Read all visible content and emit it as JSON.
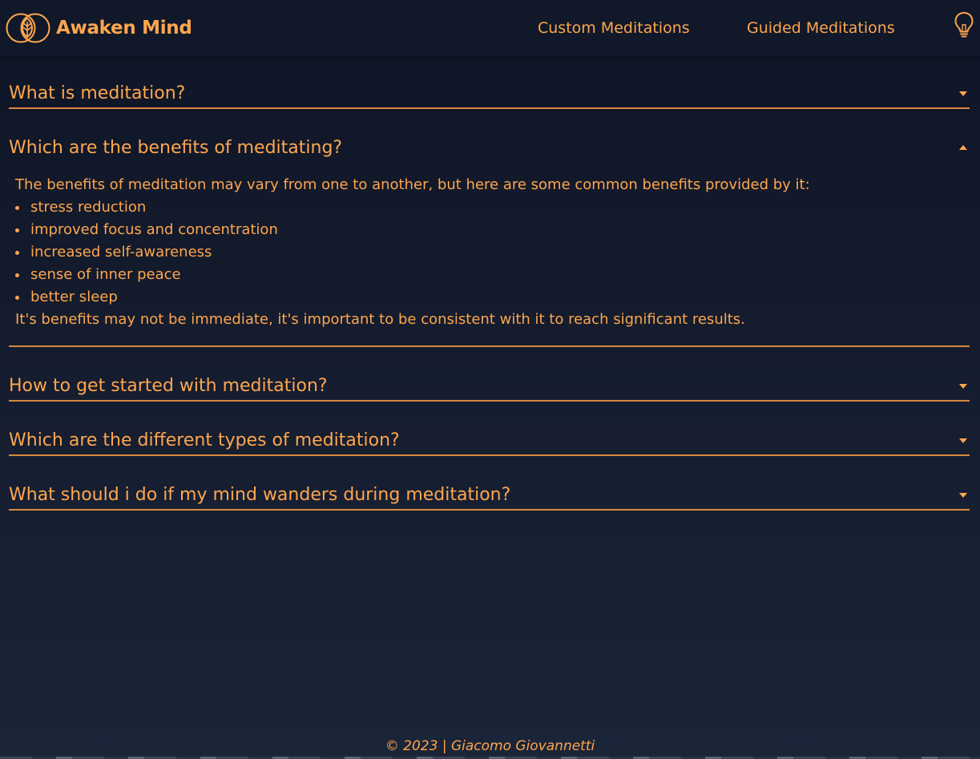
{
  "header": {
    "brand": "Awaken Mind",
    "nav": {
      "custom": "Custom Meditations",
      "guided": "Guided Meditations"
    },
    "icons": {
      "logo": "leaf-circles-icon",
      "theme": "lightbulb-icon"
    }
  },
  "faq": [
    {
      "question": "What is meditation?",
      "expanded": false
    },
    {
      "question": "Which are the benefits of meditating?",
      "expanded": true,
      "intro": "The benefits of meditation may vary from one to another, but here are some common benefits provided by it:",
      "items": [
        "stress reduction",
        "improved focus and concentration",
        "increased self-awareness",
        "sense of inner peace",
        "better sleep"
      ],
      "outro": "It's benefits may not be immediate, it's important to be consistent with it to reach significant results."
    },
    {
      "question": "How to get started with meditation?",
      "expanded": false
    },
    {
      "question": "Which are the different types of meditation?",
      "expanded": false
    },
    {
      "question": "What should i do if my mind wanders during meditation?",
      "expanded": false
    }
  ],
  "footer": {
    "text": "© 2023 | Giacomo Giovannetti"
  },
  "colors": {
    "accent": "#ffa64d",
    "background": "#141c2e",
    "navbar": "#10182a"
  }
}
